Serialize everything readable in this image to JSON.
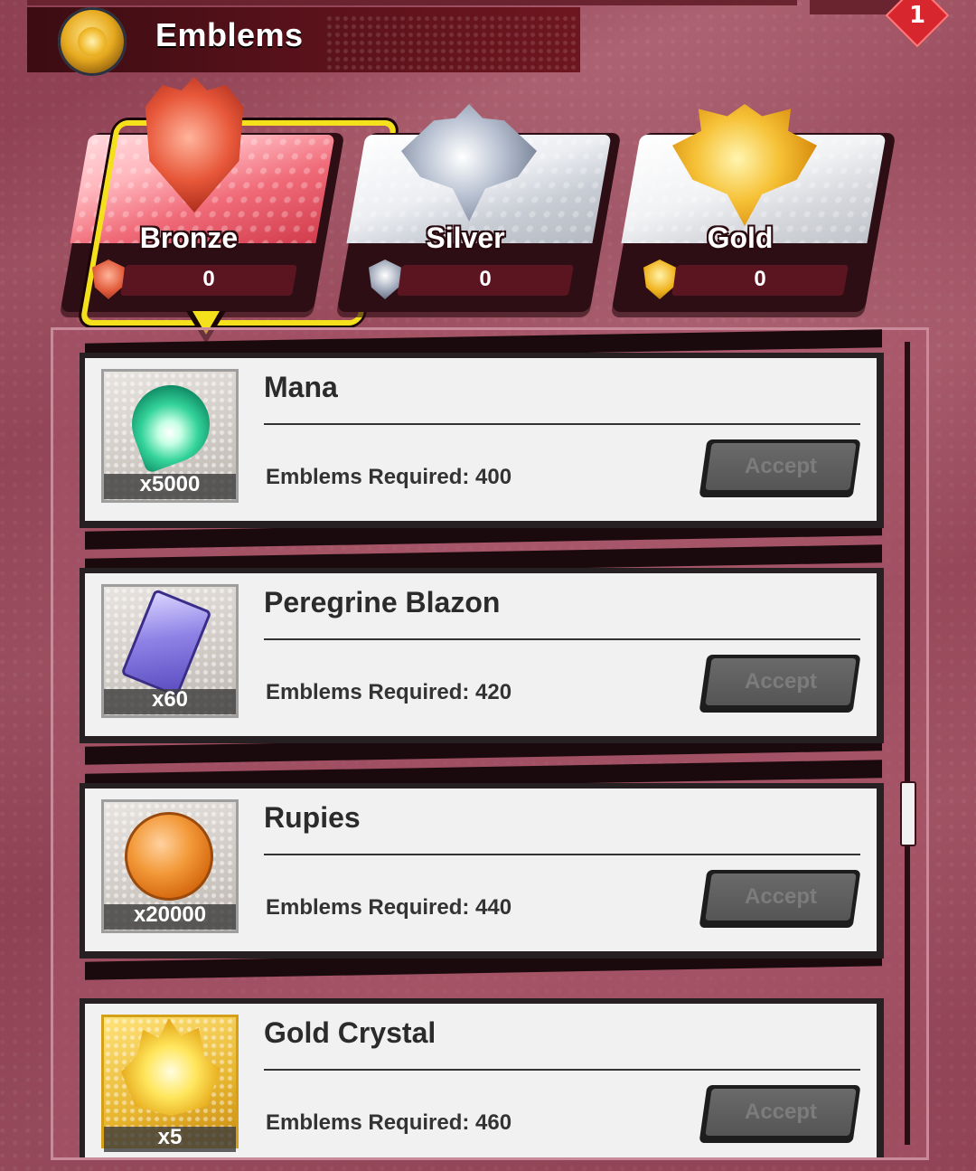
{
  "header": {
    "title": "Emblems",
    "notification_count": "1"
  },
  "tiers": [
    {
      "label": "Bronze",
      "count": "0",
      "selected": true
    },
    {
      "label": "Silver",
      "count": "0",
      "selected": false
    },
    {
      "label": "Gold",
      "count": "0",
      "selected": false
    }
  ],
  "rewards": [
    {
      "name": "Mana",
      "quantity": "x5000",
      "requirement": "Emblems Required: 400",
      "button": "Accept",
      "icon": "mana-orb-icon"
    },
    {
      "name": "Peregrine Blazon",
      "quantity": "x60",
      "requirement": "Emblems Required: 420",
      "button": "Accept",
      "icon": "blazon-card-icon"
    },
    {
      "name": "Rupies",
      "quantity": "x20000",
      "requirement": "Emblems Required: 440",
      "button": "Accept",
      "icon": "rupie-coin-icon"
    },
    {
      "name": "Gold Crystal",
      "quantity": "x5",
      "requirement": "Emblems Required: 460",
      "button": "Accept",
      "icon": "gold-crystal-icon"
    }
  ],
  "colors": {
    "selected_outline": "#f4e11c",
    "header_bg": "#5c121b",
    "background": "#a25565",
    "disabled_button": "#555555"
  }
}
